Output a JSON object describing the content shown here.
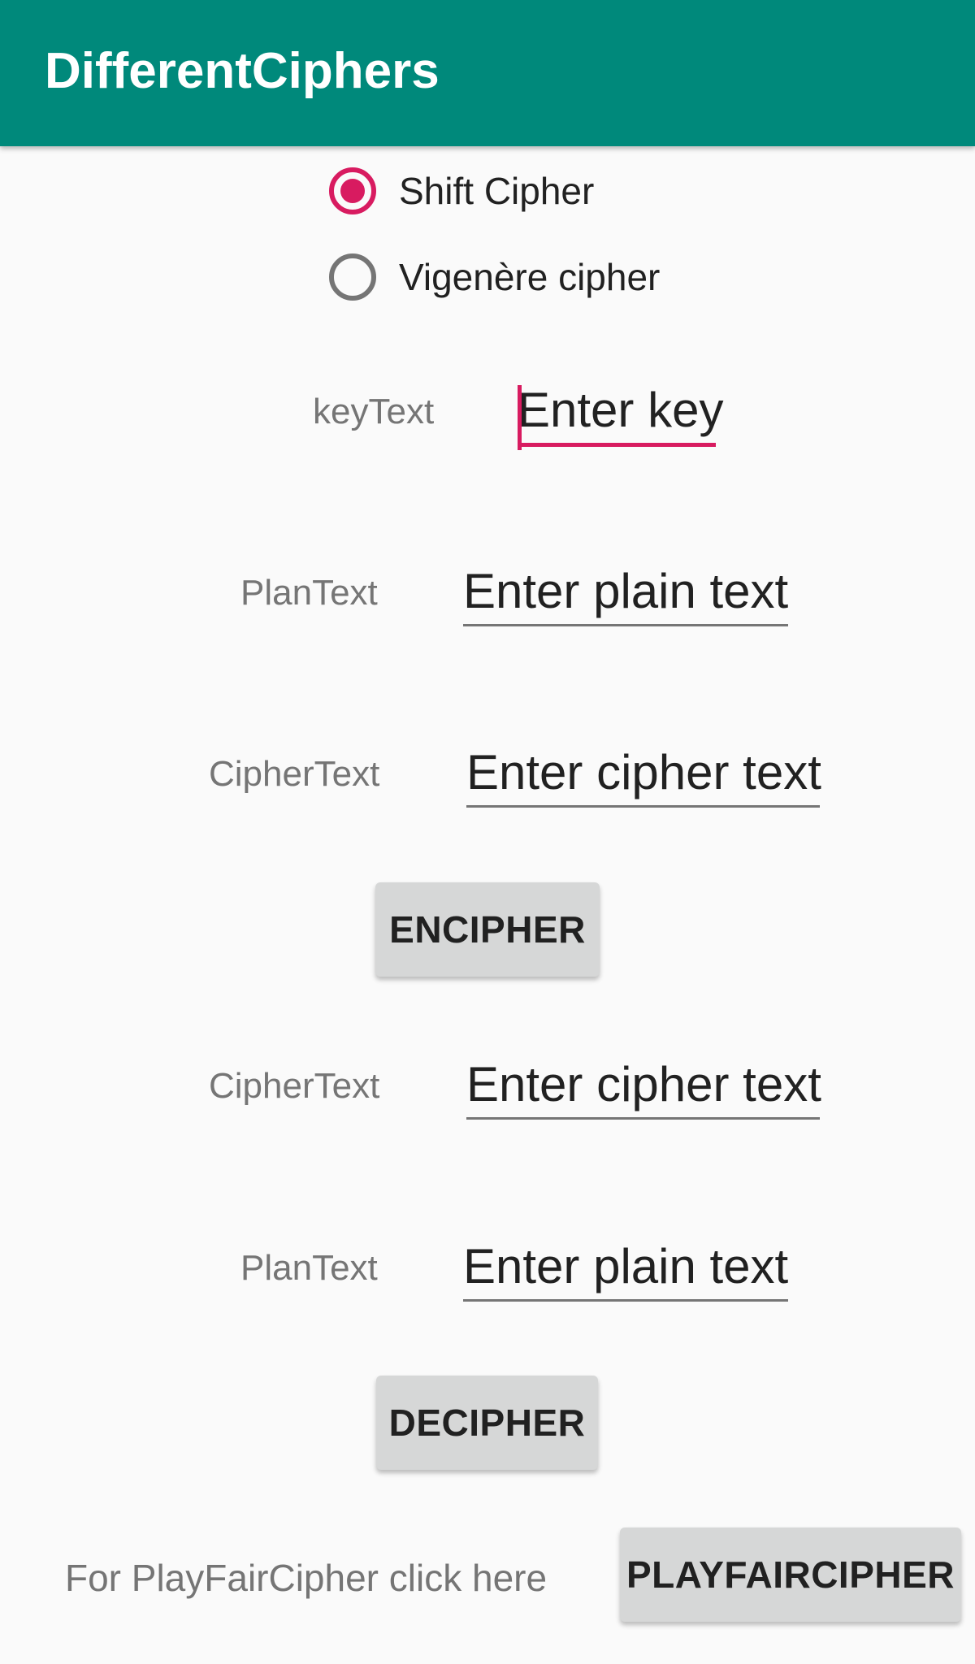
{
  "app": {
    "title": "DifferentCiphers",
    "accent_color": "#d81b60",
    "toolbar_color": "#00897b"
  },
  "cipher_options": [
    {
      "label": "Shift Cipher",
      "selected": true
    },
    {
      "label": "Vigenère cipher",
      "selected": false
    }
  ],
  "key": {
    "label": "keyText",
    "placeholder": "Enter key"
  },
  "encipher_section": {
    "plain_label": "PlanText",
    "plain_placeholder": "Enter plain text",
    "cipher_label": "CipherText",
    "cipher_placeholder": "Enter cipher text",
    "button_label": "ENCIPHER"
  },
  "decipher_section": {
    "cipher_label": "CipherText",
    "cipher_placeholder": "Enter cipher text",
    "plain_label": "PlanText",
    "plain_placeholder": "Enter plain text",
    "button_label": "DECIPHER"
  },
  "footer": {
    "prompt_text": "For PlayFairCipher click here",
    "button_label": "PLAYFAIRCIPHER"
  }
}
